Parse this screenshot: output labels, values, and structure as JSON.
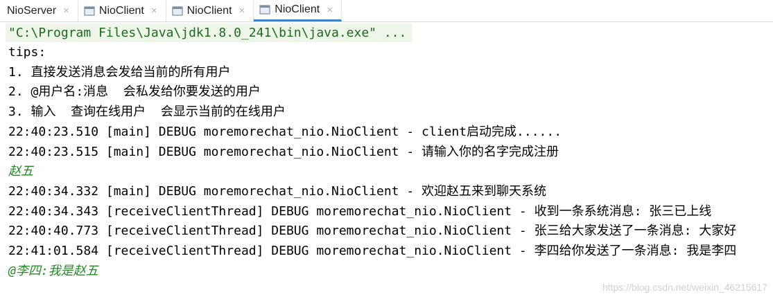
{
  "tabs": [
    {
      "label": "NioServer",
      "icon": "run-config-icon",
      "close": "×",
      "active": false
    },
    {
      "label": "NioClient",
      "icon": "run-config-icon",
      "close": "×",
      "active": false
    },
    {
      "label": "NioClient",
      "icon": "run-config-icon",
      "close": "×",
      "active": false
    },
    {
      "label": "NioClient",
      "icon": "run-config-icon",
      "close": "×",
      "active": true
    }
  ],
  "console": {
    "command": "\"C:\\Program Files\\Java\\jdk1.8.0_241\\bin\\java.exe\" ...",
    "lines": [
      "tips:",
      "1. 直接发送消息会发给当前的所有用户",
      "2. @用户名:消息  会私发给你要发送的用户",
      "3. 输入  查询在线用户  会显示当前的在线用户",
      "22:40:23.510 [main] DEBUG moremorechat_nio.NioClient - client启动完成......",
      "22:40:23.515 [main] DEBUG moremorechat_nio.NioClient - 请输入你的名字完成注册",
      "赵五",
      "22:40:34.332 [main] DEBUG moremorechat_nio.NioClient - 欢迎赵五来到聊天系统",
      "22:40:34.343 [receiveClientThread] DEBUG moremorechat_nio.NioClient - 收到一条系统消息: 张三已上线",
      "22:40:40.773 [receiveClientThread] DEBUG moremorechat_nio.NioClient - 张三给大家发送了一条消息: 大家好",
      "22:41:01.584 [receiveClientThread] DEBUG moremorechat_nio.NioClient - 李四给你发送了一条消息: 我是李四",
      "@李四:我是赵五"
    ]
  },
  "watermark": "https://blog.csdn.net/weixin_46215617",
  "colors": {
    "user_input": "#248a24",
    "command": "#1b6b1b",
    "tab_active_indicator": "#4083c9"
  }
}
